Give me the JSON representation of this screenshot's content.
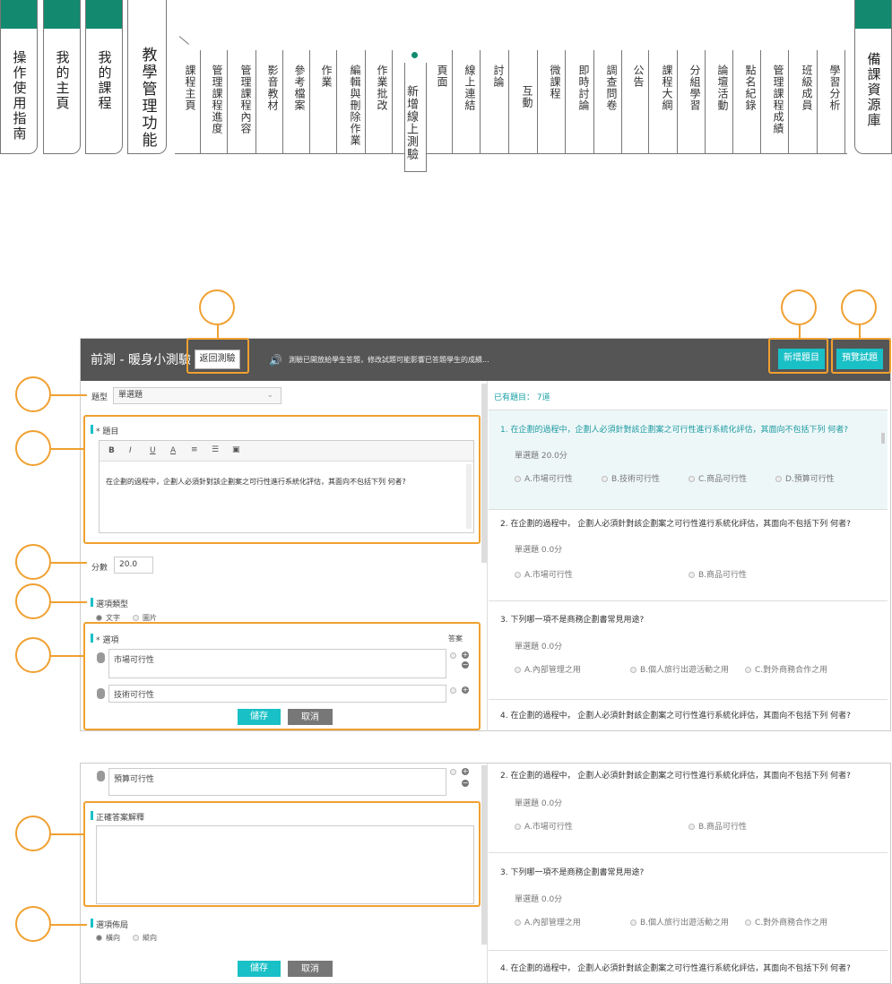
{
  "top_nav": {
    "big_tabs": [
      "操作使用指南",
      "我的主頁",
      "我的課程",
      "教學管理功能"
    ],
    "items": [
      "課程主頁",
      "管理課程進度",
      "管理課程內容",
      "影音教材",
      "參考檔案",
      "作業",
      "編輯與刪除作業",
      "作業批改",
      "新增線上測驗",
      "頁面",
      "線上連結",
      "討論",
      "互動",
      "微課程",
      "即時討論",
      "調查問卷",
      "公告",
      "課程大綱",
      "分組學習",
      "論壇活動",
      "點名紀錄",
      "管理課程成績",
      "班級成員",
      "學習分析"
    ],
    "right_tab": "備課資源庫"
  },
  "editor": {
    "title": "前測 - 暖身小測驗",
    "back_button": "返回測驗",
    "notice": "測驗已開放給學生答題，修改試題可能影響已答題學生的成績...",
    "add_button": "新增題目",
    "preview_button": "預覽試題",
    "type_label": "題型",
    "type_value": "單選題",
    "stem_label": "* 題目",
    "toolbar": [
      "B",
      "I",
      "U",
      "A",
      "≡",
      "☰",
      "▣"
    ],
    "stem_text": "在企劃的過程中，企劃人必須針對該企劃案之可行性進行系統化評估，其面向不包括下列 何者?",
    "score_label": "分數",
    "score_value": "20.0",
    "option_type_label": "選項類型",
    "option_type_text": "文字",
    "option_type_image": "圖片",
    "options_label": "* 選項",
    "answer_label": "答案",
    "options": [
      "市場可行性",
      "技術可行性",
      "預算可行性"
    ],
    "save": "儲存",
    "cancel": "取消",
    "explanation_label": "正確答案解釋",
    "layout_label": "選項佈局",
    "layout_horizontal": "橫向",
    "layout_vertical": "縱向"
  },
  "question_list": {
    "count_label": "已有題目：  7道",
    "q1": {
      "text": "1.   在企劃的過程中，企劃人必須針對該企劃案之可行性進行系統化評估，其面向不包括下列 何者?",
      "meta": "單選題 20.0分",
      "opts": [
        "A.市場可行性",
        "B.技術可行性",
        "C.商品可行性",
        "D.預算可行性"
      ]
    },
    "q2": {
      "text": "2.   在企劃的過程中， 企劃人必須針對該企劃案之可行性進行系統化評估，其面向不包括下列 何者?",
      "meta": "單選題 0.0分",
      "opts": [
        "A.市場可行性",
        "B.商品可行性"
      ]
    },
    "q3": {
      "text": "3.   下列哪一項不是商務企劃書常見用途?",
      "meta": "單選題 0.0分",
      "opts": [
        "A.內部管理之用",
        "B.個人旅行出遊活動之用",
        "C.對外商務合作之用"
      ]
    },
    "q4": {
      "text": "4.   在企劃的過程中， 企劃人必須針對該企劃案之可行性進行系統化評估，其面向不包括下列 何者?"
    }
  },
  "colors": {
    "accent": "#19c0c6",
    "header": "#555555",
    "highlight": "#f0a030",
    "nav_green": "#138a6f"
  }
}
